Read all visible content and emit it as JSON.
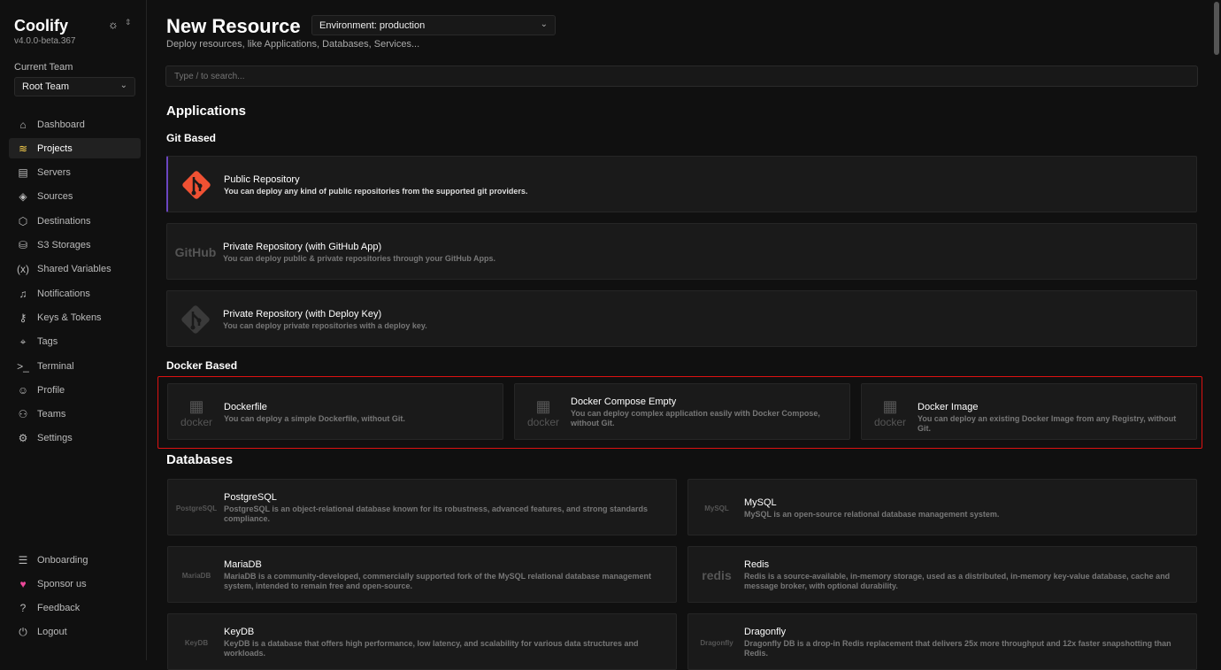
{
  "sidebar": {
    "brand": "Coolify",
    "version": "v4.0.0-beta.367",
    "team_label": "Current Team",
    "team": "Root Team",
    "items": [
      {
        "label": "Dashboard",
        "icon": "home-icon",
        "g": "⌂"
      },
      {
        "label": "Projects",
        "icon": "layers-icon",
        "g": "≋"
      },
      {
        "label": "Servers",
        "icon": "server-icon",
        "g": "▤"
      },
      {
        "label": "Sources",
        "icon": "git-icon",
        "g": "◈"
      },
      {
        "label": "Destinations",
        "icon": "destination-icon",
        "g": "⬡"
      },
      {
        "label": "S3 Storages",
        "icon": "database-icon",
        "g": "⛁"
      },
      {
        "label": "Shared Variables",
        "icon": "variable-icon",
        "g": "(x)"
      },
      {
        "label": "Notifications",
        "icon": "bell-icon",
        "g": "♫"
      },
      {
        "label": "Keys & Tokens",
        "icon": "key-icon",
        "g": "⚷"
      },
      {
        "label": "Tags",
        "icon": "tag-icon",
        "g": "⌖"
      },
      {
        "label": "Terminal",
        "icon": "terminal-icon",
        "g": ">_"
      },
      {
        "label": "Profile",
        "icon": "user-icon",
        "g": "☺"
      },
      {
        "label": "Teams",
        "icon": "team-icon",
        "g": "⚇"
      },
      {
        "label": "Settings",
        "icon": "gear-icon",
        "g": "⚙"
      }
    ],
    "bottom": [
      {
        "label": "Onboarding",
        "icon": "checklist-icon",
        "g": "☰"
      },
      {
        "label": "Sponsor us",
        "icon": "heart-icon",
        "g": "♥"
      },
      {
        "label": "Feedback",
        "icon": "help-icon",
        "g": "?"
      },
      {
        "label": "Logout",
        "icon": "logout-icon",
        "g": "⏻"
      }
    ]
  },
  "header": {
    "title": "New Resource",
    "environment": "Environment: production",
    "subtitle": "Deploy resources, like Applications, Databases, Services...",
    "search_placeholder": "Type / to search..."
  },
  "applications": {
    "heading": "Applications",
    "git_heading": "Git Based",
    "docker_heading": "Docker Based",
    "git": [
      {
        "title": "Public Repository",
        "desc": "You can deploy any kind of public repositories from the supported git providers.",
        "logo": "git"
      },
      {
        "title": "Private Repository (with GitHub App)",
        "desc": "You can deploy public & private repositories through your GitHub Apps.",
        "logo": "GitHub"
      },
      {
        "title": "Private Repository (with Deploy Key)",
        "desc": "You can deploy private repositories with a deploy key.",
        "logo": "git"
      }
    ],
    "docker": [
      {
        "title": "Dockerfile",
        "desc": "You can deploy a simple Dockerfile, without Git.",
        "logo": "docker"
      },
      {
        "title": "Docker Compose Empty",
        "desc": "You can deploy complex application easily with Docker Compose, without Git.",
        "logo": "docker"
      },
      {
        "title": "Docker Image",
        "desc": "You can deploy an existing Docker Image from any Registry, without Git.",
        "logo": "docker"
      }
    ]
  },
  "databases": {
    "heading": "Databases",
    "items": [
      {
        "title": "PostgreSQL",
        "desc": "PostgreSQL is an object-relational database known for its robustness, advanced features, and strong standards compliance.",
        "logo": "PostgreSQL"
      },
      {
        "title": "MySQL",
        "desc": "MySQL is an open-source relational database management system.",
        "logo": "MySQL"
      },
      {
        "title": "MariaDB",
        "desc": "MariaDB is a community-developed, commercially supported fork of the MySQL relational database management system, intended to remain free and open-source.",
        "logo": "MariaDB"
      },
      {
        "title": "Redis",
        "desc": "Redis is a source-available, in-memory storage, used as a distributed, in-memory key-value database, cache and message broker, with optional durability.",
        "logo": "redis"
      },
      {
        "title": "KeyDB",
        "desc": "KeyDB is a database that offers high performance, low latency, and scalability for various data structures and workloads.",
        "logo": "KeyDB"
      },
      {
        "title": "Dragonfly",
        "desc": "Dragonfly DB is a drop-in Redis replacement that delivers 25x more throughput and 12x faster snapshotting than Redis.",
        "logo": "Dragonfly"
      }
    ]
  }
}
